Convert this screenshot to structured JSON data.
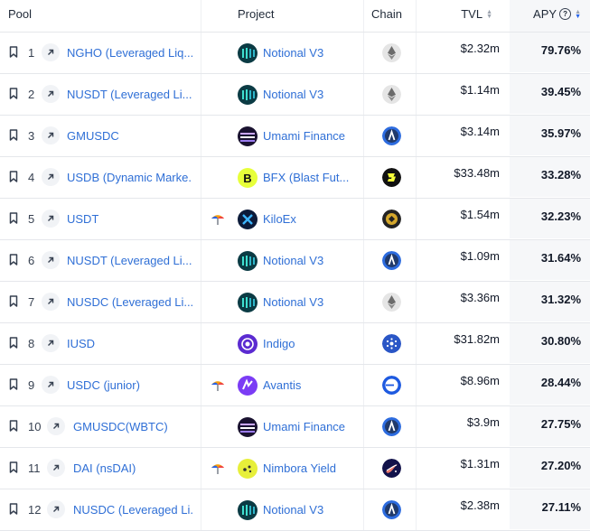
{
  "headers": {
    "pool": "Pool",
    "project": "Project",
    "chain": "Chain",
    "tvl": "TVL",
    "apy": "APY"
  },
  "rows": [
    {
      "rank": "1",
      "pool": "NGHO (Leveraged Liq...",
      "project": "Notional V3",
      "project_icon": "notional-logo",
      "chain_icon": "ethereum",
      "tvl": "$2.32m",
      "apy": "79.76%",
      "earn": false
    },
    {
      "rank": "2",
      "pool": "NUSDT (Leveraged Li...",
      "project": "Notional V3",
      "project_icon": "notional-logo",
      "chain_icon": "ethereum",
      "tvl": "$1.14m",
      "apy": "39.45%",
      "earn": false
    },
    {
      "rank": "3",
      "pool": "GMUSDC",
      "project": "Umami Finance",
      "project_icon": "umami-logo",
      "chain_icon": "arbitrum",
      "tvl": "$3.14m",
      "apy": "35.97%",
      "earn": false
    },
    {
      "rank": "4",
      "pool": "USDB (Dynamic Marke...",
      "project": "BFX (Blast Fut...",
      "project_icon": "bfx-logo",
      "chain_icon": "blast",
      "tvl": "$33.48m",
      "apy": "33.28%",
      "earn": false
    },
    {
      "rank": "5",
      "pool": "USDT",
      "project": "KiloEx",
      "project_icon": "kiloex-logo",
      "chain_icon": "bsc",
      "tvl": "$1.54m",
      "apy": "32.23%",
      "earn": true
    },
    {
      "rank": "6",
      "pool": "NUSDT (Leveraged Li...",
      "project": "Notional V3",
      "project_icon": "notional-logo",
      "chain_icon": "arbitrum",
      "tvl": "$1.09m",
      "apy": "31.64%",
      "earn": false
    },
    {
      "rank": "7",
      "pool": "NUSDC (Leveraged Li...",
      "project": "Notional V3",
      "project_icon": "notional-logo",
      "chain_icon": "ethereum",
      "tvl": "$3.36m",
      "apy": "31.32%",
      "earn": false
    },
    {
      "rank": "8",
      "pool": "IUSD",
      "project": "Indigo",
      "project_icon": "indigo-logo",
      "chain_icon": "cardano",
      "tvl": "$31.82m",
      "apy": "30.80%",
      "earn": false
    },
    {
      "rank": "9",
      "pool": "USDC (junior)",
      "project": "Avantis",
      "project_icon": "avantis-logo",
      "chain_icon": "base",
      "tvl": "$8.96m",
      "apy": "28.44%",
      "earn": true
    },
    {
      "rank": "10",
      "pool": "GMUSDC(WBTC)",
      "project": "Umami Finance",
      "project_icon": "umami-logo",
      "chain_icon": "arbitrum",
      "tvl": "$3.9m",
      "apy": "27.75%",
      "earn": false
    },
    {
      "rank": "11",
      "pool": "DAI (nsDAI)",
      "project": "Nimbora Yield",
      "project_icon": "nimbora-logo",
      "chain_icon": "starknet",
      "tvl": "$1.31m",
      "apy": "27.20%",
      "earn": true
    },
    {
      "rank": "12",
      "pool": "NUSDC (Leveraged Li...",
      "project": "Notional V3",
      "project_icon": "notional-logo",
      "chain_icon": "arbitrum",
      "tvl": "$2.38m",
      "apy": "27.11%",
      "earn": false
    }
  ],
  "colors": {
    "link": "#2f6fd6",
    "apy_bg": "#f6f7f9",
    "sort_active": "#2563eb",
    "border": "#e5e7eb"
  }
}
